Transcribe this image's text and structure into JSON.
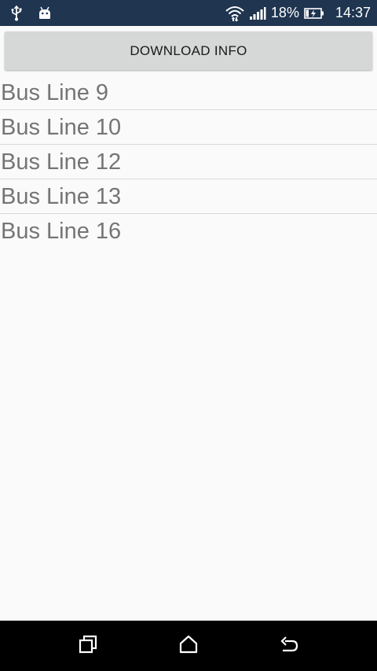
{
  "status_bar": {
    "battery_percent": "18%",
    "time": "14:37",
    "icons": [
      "usb-icon",
      "android-debug-icon",
      "wifi-icon",
      "signal-icon",
      "battery-charging-icon"
    ],
    "background": "#1f3550"
  },
  "download_button": {
    "label": "DOWNLOAD INFO"
  },
  "bus_lines": [
    {
      "label": "Bus Line 9"
    },
    {
      "label": "Bus Line 10"
    },
    {
      "label": "Bus Line 12"
    },
    {
      "label": "Bus Line 13"
    },
    {
      "label": "Bus Line 16"
    }
  ],
  "nav_bar": {
    "icons": [
      "recent-apps-icon",
      "home-icon",
      "back-icon"
    ]
  },
  "colors": {
    "list_text": "#757575",
    "button_bg": "#d6d7d7",
    "divider": "#d9d9d9"
  }
}
